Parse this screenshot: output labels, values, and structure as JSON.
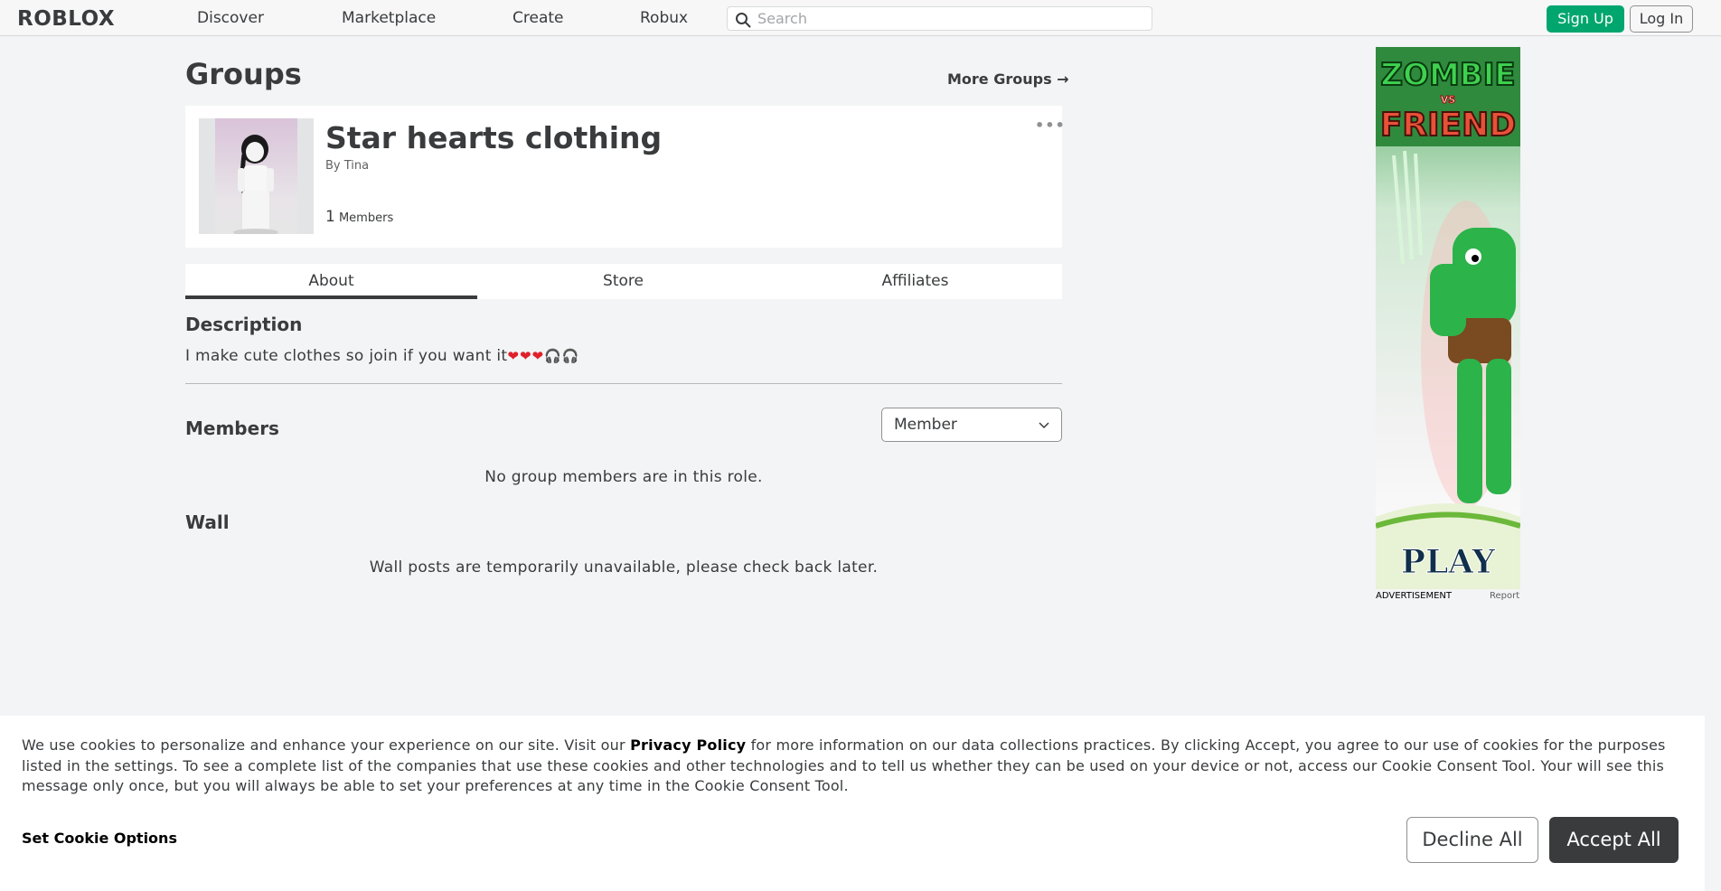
{
  "nav": {
    "logo": "ROBLOX",
    "links": [
      "Discover",
      "Marketplace",
      "Create",
      "Robux"
    ],
    "search_placeholder": "Search",
    "signup_label": "Sign Up",
    "login_label": "Log In"
  },
  "page": {
    "title": "Groups",
    "more_groups": "More Groups →"
  },
  "group": {
    "name": "Star hearts clothing",
    "by_prefix": "By",
    "owner": "Tina",
    "member_count": "1",
    "members_label": "Members",
    "more_menu": "•••"
  },
  "tabs": [
    "About",
    "Store",
    "Affiliates"
  ],
  "about": {
    "description_title": "Description",
    "description_text": "I make cute clothes so join if you want it",
    "description_emoji": "❤❤❤🎧🎧",
    "members_title": "Members",
    "role_selected": "Member",
    "members_empty": "No group members are in this role.",
    "wall_title": "Wall",
    "wall_empty": "Wall posts are temporarily unavailable, please check back later."
  },
  "ad": {
    "title_top": "ZOMBIE",
    "title_mid": "VS",
    "title_bottom": "FRIEND",
    "cta": "PLAY",
    "label": "ADVERTISEMENT",
    "report": "Report"
  },
  "cookie": {
    "text_before": "We use cookies to personalize and enhance your experience on our site. Visit our ",
    "privacy_link": "Privacy Policy",
    "text_after": " for more information on our data collections practices. By clicking Accept, you agree to our use of cookies for the purposes listed in the settings. To see a complete list of the companies that use these cookies and other technologies and to tell us whether they can be used on your device or not, access our Cookie Consent Tool. Your will see this message only once, but you will always be able to set your preferences at any time in the Cookie Consent Tool.",
    "set_options": "Set Cookie Options",
    "decline": "Decline All",
    "accept": "Accept All"
  },
  "colors": {
    "signup_green": "#00a66e",
    "accept_dark": "#393b3d",
    "heart_red": "#e0202a"
  }
}
